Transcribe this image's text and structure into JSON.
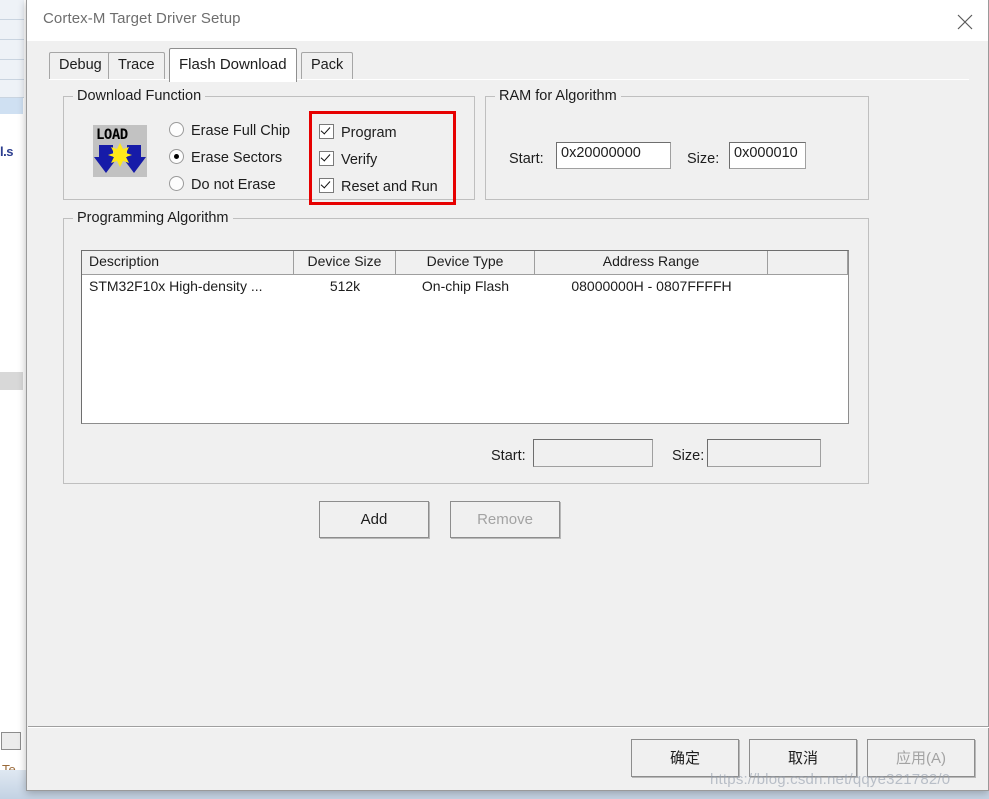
{
  "window": {
    "title": "Cortex-M Target Driver Setup",
    "close_icon": "close-icon"
  },
  "tabs": [
    {
      "label": "Debug",
      "active": false
    },
    {
      "label": "Trace",
      "active": false
    },
    {
      "label": "Flash Download",
      "active": true
    },
    {
      "label": "Pack",
      "active": false
    }
  ],
  "download_function": {
    "legend": "Download Function",
    "icon_label": "LOAD",
    "erase_options": [
      {
        "label": "Erase Full Chip",
        "selected": false
      },
      {
        "label": "Erase Sectors",
        "selected": true
      },
      {
        "label": "Do not Erase",
        "selected": false
      }
    ],
    "checkboxes": [
      {
        "label": "Program",
        "checked": true
      },
      {
        "label": "Verify",
        "checked": true
      },
      {
        "label": "Reset and Run",
        "checked": true
      }
    ],
    "highlight_color": "#e60000"
  },
  "ram_for_algorithm": {
    "legend": "RAM for Algorithm",
    "start_label": "Start:",
    "start_value": "0x20000000",
    "size_label": "Size:",
    "size_value": "0x000010"
  },
  "programming_algorithm": {
    "legend": "Programming Algorithm",
    "columns": [
      "Description",
      "Device Size",
      "Device Type",
      "Address Range",
      ""
    ],
    "rows": [
      {
        "description": "STM32F10x High-density ...",
        "device_size": "512k",
        "device_type": "On-chip Flash",
        "address_range": "08000000H - 0807FFFFH"
      }
    ],
    "start_label": "Start:",
    "start_value": "",
    "size_label": "Size:",
    "size_value": "",
    "add_button": "Add",
    "remove_button": "Remove",
    "remove_enabled": false
  },
  "footer": {
    "ok_button": "确定",
    "cancel_button": "取消",
    "apply_button": "应用(A)",
    "apply_enabled": false
  },
  "watermark": "https://blog.csdn.net/qqye321782/0",
  "background": {
    "fragment_left": "l.s",
    "fragment_bottom": "Te"
  }
}
